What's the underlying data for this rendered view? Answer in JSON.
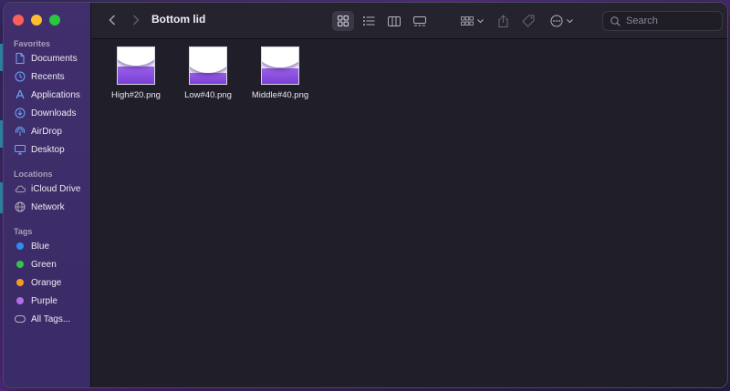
{
  "window": {
    "title": "Bottom lid"
  },
  "sidebar": {
    "sections": [
      {
        "title": "Favorites",
        "items": [
          {
            "label": "Documents",
            "icon": "document-icon"
          },
          {
            "label": "Recents",
            "icon": "clock-icon"
          },
          {
            "label": "Applications",
            "icon": "applications-icon"
          },
          {
            "label": "Downloads",
            "icon": "download-icon"
          },
          {
            "label": "AirDrop",
            "icon": "airdrop-icon"
          },
          {
            "label": "Desktop",
            "icon": "desktop-icon"
          }
        ]
      },
      {
        "title": "Locations",
        "items": [
          {
            "label": "iCloud Drive",
            "icon": "cloud-icon"
          },
          {
            "label": "Network",
            "icon": "globe-icon"
          }
        ]
      },
      {
        "title": "Tags",
        "items": [
          {
            "label": "Blue",
            "color": "#2f8cf0"
          },
          {
            "label": "Green",
            "color": "#36c24b"
          },
          {
            "label": "Orange",
            "color": "#f39b22"
          },
          {
            "label": "Purple",
            "color": "#b46de8"
          },
          {
            "label": "All Tags...",
            "icon": "tag-outline-icon"
          }
        ]
      }
    ]
  },
  "toolbar": {
    "views": [
      "icon-view-icon",
      "list-view-icon",
      "column-view-icon",
      "gallery-view-icon"
    ],
    "active_view": "icon-view-icon",
    "search_placeholder": "Search"
  },
  "files": [
    {
      "name": "High#20.png",
      "fill_fraction": 0.48
    },
    {
      "name": "Low#40.png",
      "fill_fraction": 0.3
    },
    {
      "name": "Middle#40.png",
      "fill_fraction": 0.42
    }
  ],
  "colors": {
    "accent": "#6ea8ff",
    "thumb_purple": "#7b3fd6"
  }
}
